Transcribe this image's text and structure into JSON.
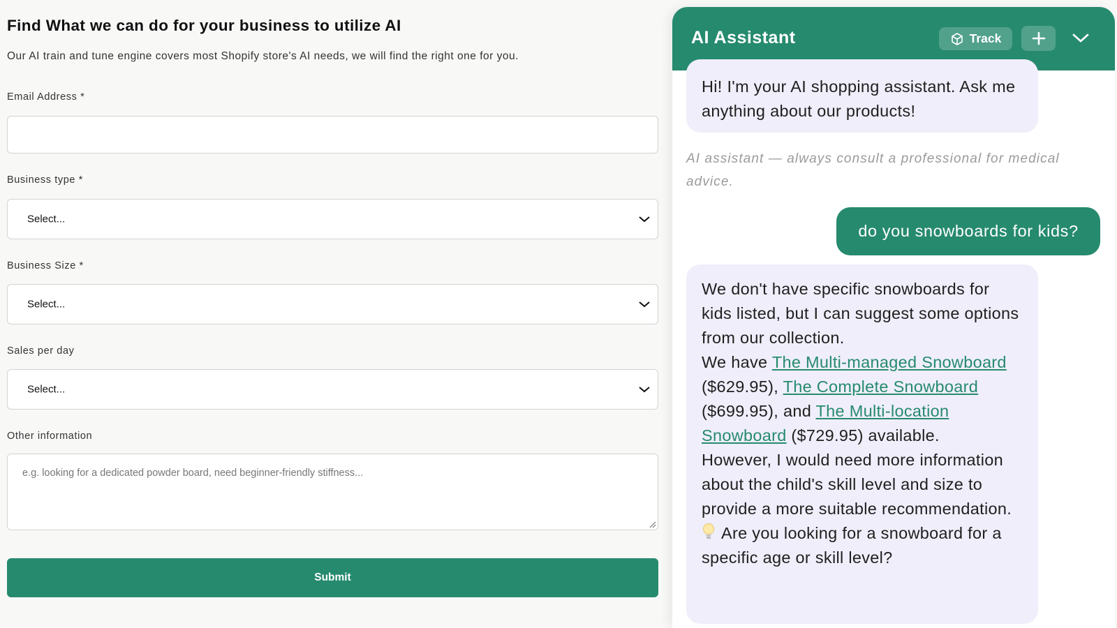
{
  "form": {
    "title": "Find What we can do for your business to utilize AI",
    "subtitle": "Our AI train and tune engine covers most Shopify store's AI needs, we will find the right one for you.",
    "email_label": "Email Address *",
    "email_value": "",
    "business_type_label": "Business type *",
    "business_type_value": "Select...",
    "business_size_label": "Business Size *",
    "business_size_value": "Select...",
    "sales_label": "Sales per day",
    "sales_value": "Select...",
    "other_label": "Other information",
    "other_placeholder": "e.g. looking for a dedicated powder board, need beginner-friendly stiffness...",
    "submit_label": "Submit"
  },
  "chat": {
    "title": "AI Assistant",
    "track_label": "Track",
    "greeting": "Hi! I'm your AI shopping assistant. Ask me anything about our products!",
    "disclaimer": "AI assistant — always consult a professional for medical advice.",
    "user_message": "do you snowboards for kids?",
    "answer": {
      "intro": "We don't have specific snowboards for kids listed, but I can suggest some options from our collection.",
      "we_have": "We have ",
      "product_1": "The Multi-managed Snowboard",
      "price_1": " ($629.95), ",
      "product_2": "The Complete Snowboard",
      "price_2": " ($699.95), and ",
      "product_3": "The Multi-location Snowboard",
      "price_3": " ($729.95) available.",
      "followup": "However, I would need more information about the child's skill level and size to provide a more suitable recommendation.",
      "question": "Are you looking for a snowboard for a specific age or skill level?"
    },
    "icons": [
      "cube-icon",
      "plus-icon",
      "chevron-down-icon",
      "lightbulb-icon"
    ]
  },
  "colors": {
    "brand_green": "#268a6e",
    "assistant_bubble": "#efeefa",
    "page_bg": "#f8f8f7"
  }
}
